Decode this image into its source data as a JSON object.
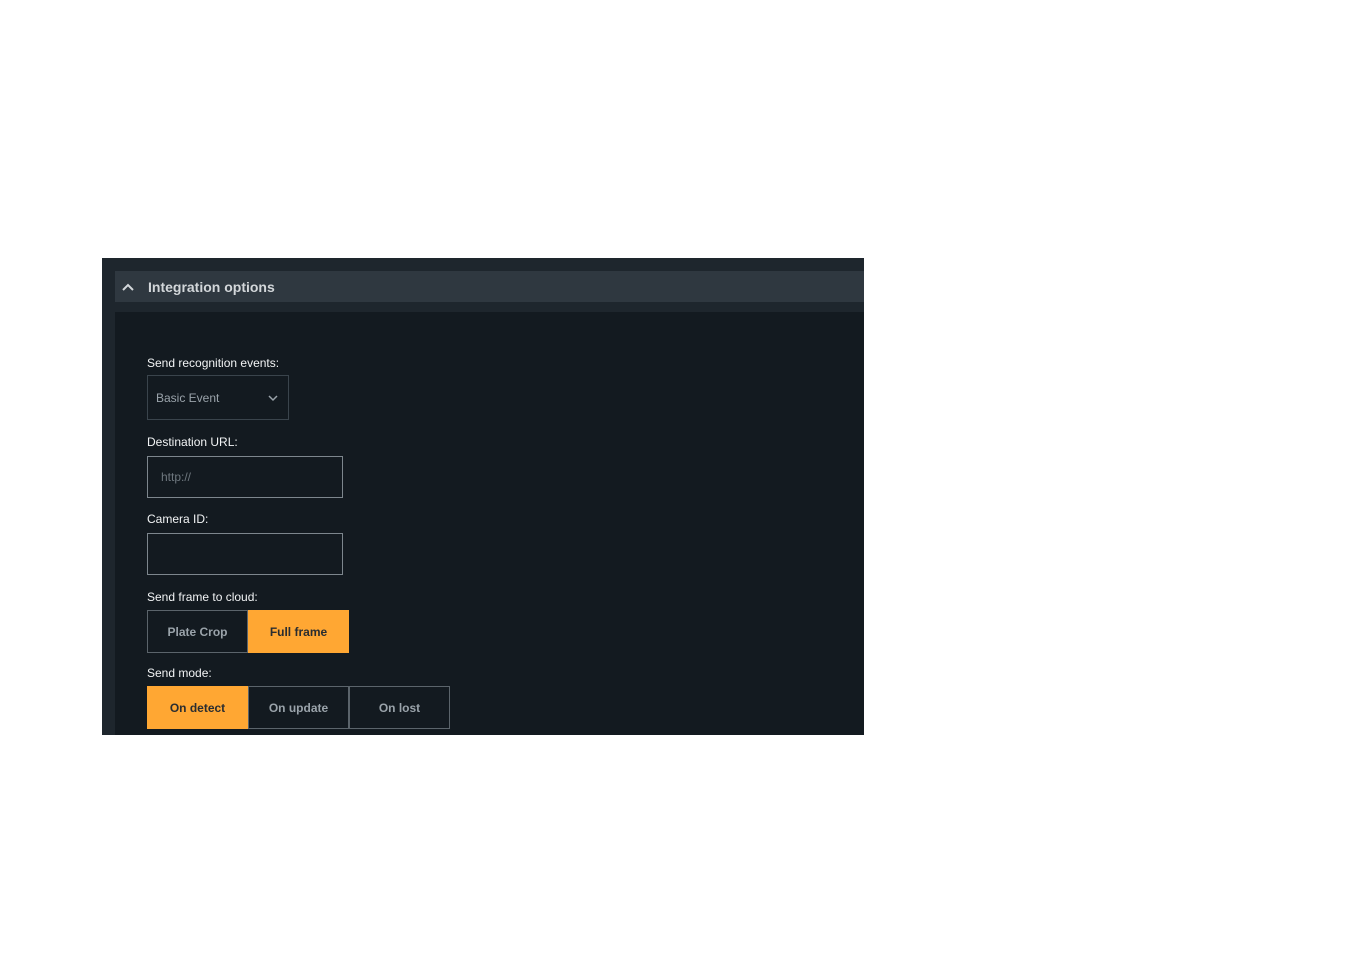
{
  "section": {
    "title": "Integration options",
    "toggle_icon": "chevron-up-icon"
  },
  "recognition_events": {
    "label": "Send recognition events:",
    "selected": "Basic Event",
    "dropdown_icon": "chevron-down-icon"
  },
  "destination_url": {
    "label": "Destination URL:",
    "value": "",
    "placeholder": "http://"
  },
  "camera_id": {
    "label": "Camera ID:",
    "value": "",
    "placeholder": ""
  },
  "frame_to_cloud": {
    "label": "Send frame to cloud:",
    "options": [
      "Plate Crop",
      "Full frame"
    ],
    "selected": "Full frame"
  },
  "send_mode": {
    "label": "Send mode:",
    "options": [
      "On detect",
      "On update",
      "On lost"
    ],
    "selected": "On detect"
  },
  "colors": {
    "accent": "#ffa733",
    "panel_bg": "#131a20",
    "header_bg": "#2f3840"
  }
}
